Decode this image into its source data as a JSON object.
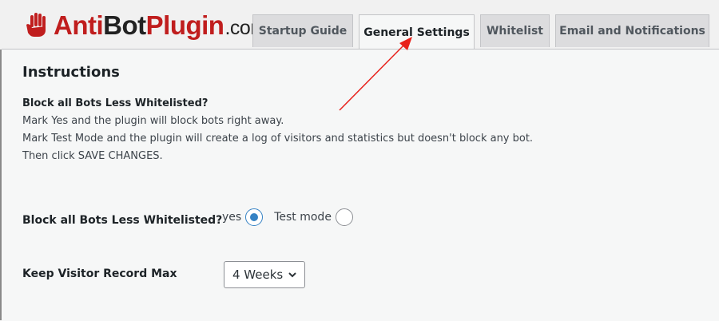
{
  "logo": {
    "part1": "Anti",
    "part2": "Bot",
    "part3": "Plugin",
    "part4": ".com",
    "icon": "raised-hand-icon",
    "brand_red": "#c01e1e"
  },
  "tabs": [
    {
      "label": "Startup Guide",
      "active": false
    },
    {
      "label": "General Settings",
      "active": true
    },
    {
      "label": "Whitelist",
      "active": false
    },
    {
      "label": "Email and Notifications",
      "active": false
    }
  ],
  "instructions": {
    "title": "Instructions",
    "question": "Block all Bots Less Whitelisted?",
    "lines": [
      "Mark Yes and the plugin will block bots right away.",
      "Mark Test Mode and the plugin will create a log of visitors and statistics but doesn't block any bot.",
      "Then click SAVE CHANGES."
    ]
  },
  "block_setting": {
    "label": "Block all Bots Less Whitelisted?",
    "options": [
      {
        "label": "yes",
        "checked": true
      },
      {
        "label": "Test mode",
        "checked": false
      }
    ]
  },
  "keep_setting": {
    "label": "Keep Visitor Record Max",
    "selected": "4 Weeks"
  },
  "colors": {
    "annotation_arrow": "#e8211b",
    "radio_accent": "#3582c4"
  }
}
